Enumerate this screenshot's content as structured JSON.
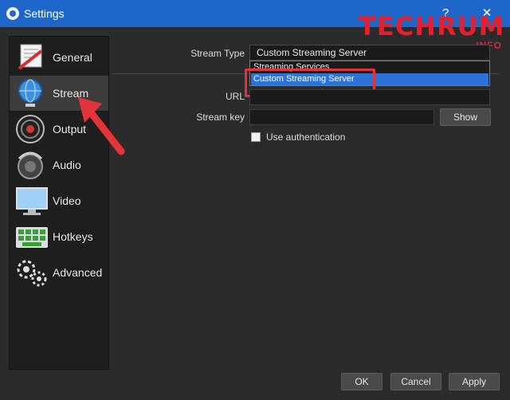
{
  "window": {
    "title": "Settings",
    "help": "?",
    "close": "✕"
  },
  "watermark": {
    "brand": "TECHRUM",
    "sub": ".INFO"
  },
  "sidebar": {
    "items": [
      {
        "label": "General",
        "icon": "general-icon"
      },
      {
        "label": "Stream",
        "icon": "stream-icon"
      },
      {
        "label": "Output",
        "icon": "output-icon"
      },
      {
        "label": "Audio",
        "icon": "audio-icon"
      },
      {
        "label": "Video",
        "icon": "video-icon"
      },
      {
        "label": "Hotkeys",
        "icon": "hotkeys-icon"
      },
      {
        "label": "Advanced",
        "icon": "advanced-icon"
      }
    ],
    "active": "Stream"
  },
  "stream": {
    "type_label": "Stream Type",
    "type_value": "Custom Streaming Server",
    "options": [
      "Streaming Services",
      "Custom Streaming Server"
    ],
    "url_label": "URL",
    "key_label": "Stream key",
    "show_label": "Show",
    "auth_label": "Use authentication"
  },
  "footer": {
    "ok": "OK",
    "cancel": "Cancel",
    "apply": "Apply"
  },
  "colors": {
    "titlebar": "#1e66c9",
    "highlight": "#e3333b",
    "selection": "#2b73d9",
    "brand": "#e3202f"
  }
}
